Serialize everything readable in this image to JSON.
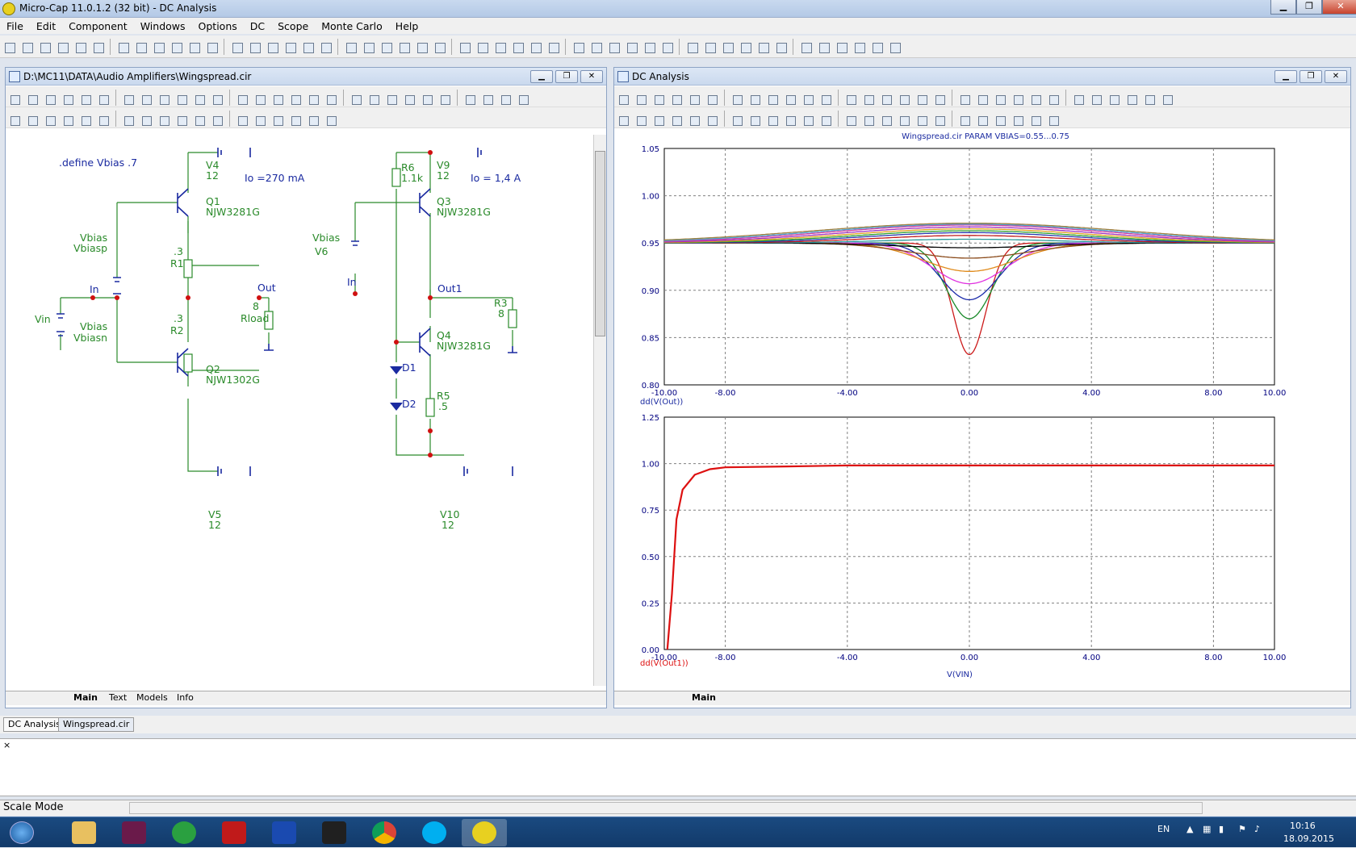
{
  "window_title": "Micro-Cap 11.0.1.2 (32 bit) - DC Analysis",
  "menu": [
    "File",
    "Edit",
    "Component",
    "Windows",
    "Options",
    "DC",
    "Scope",
    "Monte Carlo",
    "Help"
  ],
  "schematic": {
    "title": "D:\\MC11\\DATA\\Audio Amplifiers\\Wingspread.cir",
    "tabs": [
      "Main",
      "Text",
      "Models",
      "Info"
    ],
    "define_text": ".define Vbias .7",
    "note_left": "Io =270 mA",
    "note_right": "Io = 1,4 A",
    "labels": {
      "v4": "V4",
      "v4v": "12",
      "q1": "Q1",
      "q1m": "NJW3281G",
      "vbias1": "Vbias",
      "vbiasp": "Vbiasp",
      "r1v": ".3",
      "r1": "R1",
      "in_node": "In",
      "out_node": "Out",
      "rload_v": "8",
      "rload": "Rload",
      "vin": "Vin",
      "vbias2": "Vbias",
      "vbiasn": "Vbiasn",
      "r2v": ".3",
      "r2": "R2",
      "q2": "Q2",
      "q2m": "NJW1302G",
      "v5": "V5",
      "v5v": "12",
      "r6": "R6",
      "r6v": "1.1k",
      "v9": "V9",
      "v9v": "12",
      "q3": "Q3",
      "q3m": "NJW3281G",
      "vbias3": "Vbias",
      "v6": "V6",
      "in2": "In",
      "out1": "Out1",
      "r3": "R3",
      "r3v": "8",
      "q4": "Q4",
      "q4m": "NJW3281G",
      "d1": "D1",
      "d2": "D2",
      "r5": "R5",
      "r5v": ".5",
      "v10": "V10",
      "v10v": "12"
    }
  },
  "analysis": {
    "title": "DC Analysis",
    "tab": "Main",
    "x_label": "V(VIN)",
    "colors": {
      "trace_red": "#dd1010",
      "grid": "#808080",
      "axis_text": "#000080"
    }
  },
  "chart_data": [
    {
      "type": "line",
      "title": "Wingspread.cir PARAM VBIAS=0.55...0.75",
      "ylabel": "dd(V(Out))",
      "xlim": [
        -10,
        10
      ],
      "ylim": [
        0.8,
        1.05
      ],
      "x_ticks": [
        "-10.00",
        "-8.00",
        "-4.00",
        "0.00",
        "4.00",
        "8.00",
        "10.00"
      ],
      "y_ticks": [
        "0.80",
        "0.85",
        "0.90",
        "0.95",
        "1.00",
        "1.05"
      ],
      "series": [
        {
          "color": "#cc1a1a",
          "base": 0.95,
          "dip": -0.118,
          "width": 0.55
        },
        {
          "color": "#1a8a2a",
          "base": 0.95,
          "dip": -0.08,
          "width": 0.75
        },
        {
          "color": "#1a2aaa",
          "base": 0.95,
          "dip": -0.06,
          "width": 0.95
        },
        {
          "color": "#e030e0",
          "base": 0.95,
          "dip": -0.043,
          "width": 1.2
        },
        {
          "color": "#e08a1a",
          "base": 0.95,
          "dip": -0.03,
          "width": 1.5
        },
        {
          "color": "#8a4a1a",
          "base": 0.95,
          "dip": -0.016,
          "width": 1.9
        },
        {
          "color": "#000000",
          "base": 0.95,
          "dip": -0.005,
          "width": 2.3
        },
        {
          "color": "#2a9a9a",
          "base": 0.95,
          "dip": 0.004,
          "width": 2.8
        },
        {
          "color": "#c01a1a",
          "base": 0.95,
          "dip": 0.008,
          "width": 3.1
        },
        {
          "color": "#2a3ab0",
          "base": 0.95,
          "dip": 0.011,
          "width": 3.4
        },
        {
          "color": "#30a030",
          "base": 0.95,
          "dip": 0.013,
          "width": 3.7
        },
        {
          "color": "#e0a020",
          "base": 0.95,
          "dip": 0.015,
          "width": 4.0
        },
        {
          "color": "#a030c0",
          "base": 0.95,
          "dip": 0.017,
          "width": 4.3
        },
        {
          "color": "#d040a0",
          "base": 0.95,
          "dip": 0.019,
          "width": 4.6
        },
        {
          "color": "#4aa0d0",
          "base": 0.95,
          "dip": 0.02,
          "width": 4.9
        },
        {
          "color": "#a08040",
          "base": 0.95,
          "dip": 0.021,
          "width": 5.2
        }
      ]
    },
    {
      "type": "line",
      "ylabel": "dd(V(Out1))",
      "xlabel": "V(VIN)",
      "xlim": [
        -10,
        10
      ],
      "ylim": [
        0,
        1.25
      ],
      "x_ticks": [
        "-10.00",
        "-8.00",
        "-4.00",
        "0.00",
        "4.00",
        "8.00",
        "10.00"
      ],
      "y_ticks": [
        "0.00",
        "0.25",
        "0.50",
        "0.75",
        "1.00",
        "1.25"
      ],
      "series": [
        {
          "color": "#dd1010",
          "points": [
            [
              -9.9,
              0.0
            ],
            [
              -9.75,
              0.3
            ],
            [
              -9.6,
              0.7
            ],
            [
              -9.4,
              0.86
            ],
            [
              -9.0,
              0.94
            ],
            [
              -8.5,
              0.97
            ],
            [
              -8.0,
              0.98
            ],
            [
              -6,
              0.985
            ],
            [
              -4,
              0.99
            ],
            [
              0,
              0.99
            ],
            [
              4,
              0.99
            ],
            [
              8,
              0.99
            ],
            [
              10,
              0.99
            ]
          ]
        }
      ]
    }
  ],
  "doc_tabs": [
    "DC Analysis",
    "Wingspread.cir"
  ],
  "status": "Scale Mode",
  "tray": {
    "lang": "EN",
    "time": "10:16",
    "date": "18.09.2015"
  }
}
